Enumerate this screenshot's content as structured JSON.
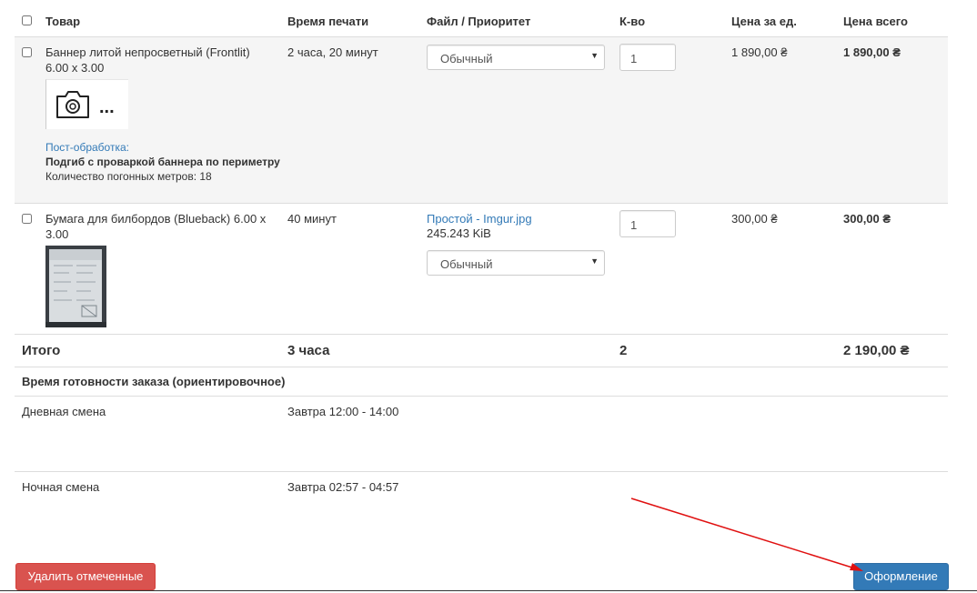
{
  "table": {
    "headers": {
      "product": "Товар",
      "print_time": "Время печати",
      "file_priority": "Файл / Приоритет",
      "qty": "К-во",
      "unit_price": "Цена за ед.",
      "total_price": "Цена всего"
    },
    "rows": [
      {
        "name": "Баннер литой непросветный (Frontlit) 6.00 x 3.00",
        "print_time": "2 часа, 20 минут",
        "priority": "Обычный",
        "qty": "1",
        "unit_price": "1 890,00 ₴",
        "total_price": "1 890,00 ₴",
        "thumb_dots": "...",
        "post_label": "Пост-обработка:",
        "post_title": "Подгиб с проваркой баннера по периметру",
        "post_detail": "Количество погонных метров: 18"
      },
      {
        "name": "Бумага для билбордов (Blueback) 6.00 x 3.00",
        "print_time": "40 минут",
        "file_link": "Простой - Imgur.jpg",
        "file_size": "245.243 KiB",
        "priority": "Обычный",
        "qty": "1",
        "unit_price": "300,00 ₴",
        "total_price": "300,00 ₴"
      }
    ],
    "total": {
      "label": "Итого",
      "print_time": "3 часа",
      "qty": "2",
      "total_price": "2 190,00 ₴"
    }
  },
  "ready_time": {
    "title": "Время готовности заказа (ориентировочное)",
    "day_label": "Дневная смена",
    "day_value": "Завтра 12:00 - 14:00",
    "night_label": "Ночная смена",
    "night_value": "Завтра 02:57 - 04:57"
  },
  "buttons": {
    "delete_label": "Удалить отмеченные",
    "checkout_label": "Оформление"
  },
  "colors": {
    "delete_button": "#d9534f",
    "checkout_button": "#337ab7",
    "link": "#337ab7",
    "annotation_arrow": "#e01010"
  }
}
